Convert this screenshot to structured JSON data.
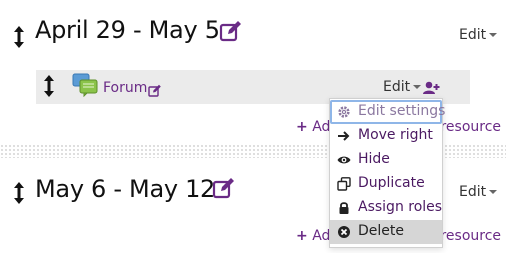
{
  "sections": [
    {
      "title": "April 29 - May 5",
      "edit_label": "Edit",
      "add_label": "Add an activity or resource"
    },
    {
      "title": "May 6 - May 12",
      "edit_label": "Edit",
      "add_label": "Add an activity or resource"
    }
  ],
  "activity": {
    "name": "Forum",
    "edit_label": "Edit"
  },
  "menu": {
    "items": [
      {
        "label": "Edit settings",
        "icon": "gear-icon"
      },
      {
        "label": "Move right",
        "icon": "arrow-right-icon"
      },
      {
        "label": "Hide",
        "icon": "eye-icon"
      },
      {
        "label": "Duplicate",
        "icon": "duplicate-icon"
      },
      {
        "label": "Assign roles",
        "icon": "lock-icon"
      },
      {
        "label": "Delete",
        "icon": "close-circle-icon"
      }
    ]
  },
  "colors": {
    "accent": "#6a2b86",
    "menu_text": "#4b1a62",
    "focus": "#8fb6e8",
    "row_bg": "#ebebeb",
    "hover_bg": "#d6d6d6"
  }
}
